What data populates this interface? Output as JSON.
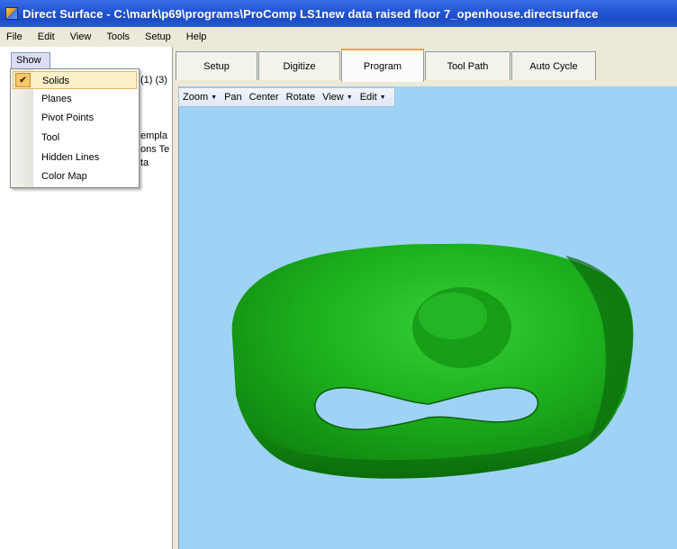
{
  "window": {
    "title": "Direct Surface - C:\\mark\\p69\\programs\\ProComp LS1new data raised floor 7_openhouse.directsurface",
    "icon": "app-icon"
  },
  "menubar": [
    "File",
    "Edit",
    "View",
    "Tools",
    "Setup",
    "Help"
  ],
  "left_panel": {
    "show_tab": "Show",
    "tree_fragments": [
      "(1) (3)",
      "empla",
      "ons Te",
      "ta"
    ]
  },
  "show_menu": {
    "items": [
      {
        "label": "Solids",
        "checked": true,
        "selected": true
      },
      {
        "label": "Planes",
        "checked": false
      },
      {
        "label": "Pivot Points",
        "checked": false
      },
      {
        "label": "Tool",
        "checked": false
      },
      {
        "label": "Hidden Lines",
        "checked": false
      },
      {
        "label": "Color Map",
        "checked": false
      }
    ]
  },
  "tabs": [
    {
      "label": "Setup",
      "active": false
    },
    {
      "label": "Digitize",
      "active": false
    },
    {
      "label": "Program",
      "active": true
    },
    {
      "label": "Tool Path",
      "active": false
    },
    {
      "label": "Auto Cycle",
      "active": false
    }
  ],
  "view_toolbar": [
    {
      "label": "Zoom",
      "dropdown": true
    },
    {
      "label": "Pan",
      "dropdown": false
    },
    {
      "label": "Center",
      "dropdown": false
    },
    {
      "label": "Rotate",
      "dropdown": false
    },
    {
      "label": "View",
      "dropdown": true
    },
    {
      "label": "Edit",
      "dropdown": true
    }
  ],
  "colors": {
    "titlebar": "#2457d6",
    "viewport_background": "#9fd3f6",
    "model": "#1aa81a",
    "active_tab_accent": "#f5a623"
  }
}
